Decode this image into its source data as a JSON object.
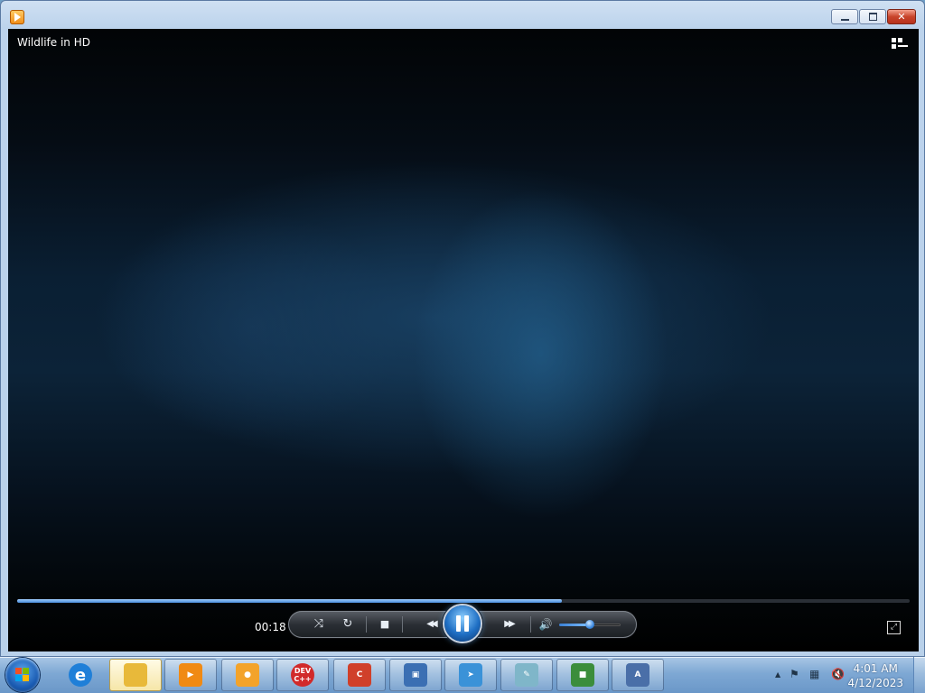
{
  "window": {
    "icons": {
      "app": "media-player-icon"
    }
  },
  "player": {
    "title": "Wildlife in HD",
    "elapsed": "00:18",
    "progress": 0.61,
    "volume": 0.5,
    "icons": {
      "switch_library": "switch-to-library-icon",
      "shuffle": "shuffle-icon",
      "repeat": "repeat-icon",
      "stop": "stop-icon",
      "previous": "previous-icon",
      "play_pause": "pause-icon",
      "next": "next-icon",
      "mute": "speaker-icon",
      "fullscreen": "fullscreen-icon"
    },
    "glyphs": {
      "shuffle": "⤨",
      "repeat": "↻",
      "stop": "■",
      "previous": "◀◀",
      "next": "▶▶",
      "mute": "🔊",
      "fullscreen": "⤢"
    }
  },
  "taskbar": {
    "pinned": [
      {
        "name": "internet-explorer",
        "label": "e",
        "color": "#1f7fd8"
      },
      {
        "name": "windows-explorer",
        "label": "",
        "color": "#e8b93a"
      },
      {
        "name": "windows-media-player",
        "label": "▶",
        "color": "#f08a14"
      },
      {
        "name": "avast-secureline",
        "label": "●",
        "color": "#f3a32a"
      },
      {
        "name": "dev-cpp",
        "label": "DEV C++",
        "color": "#d12a2a"
      },
      {
        "name": "ccleaner",
        "label": "C",
        "color": "#d0402a"
      },
      {
        "name": "remote-desktop",
        "label": "▣",
        "color": "#3b6fb3"
      },
      {
        "name": "telegram",
        "label": "➤",
        "color": "#3a92d8"
      },
      {
        "name": "notepad",
        "label": "✎",
        "color": "#7fb6c9"
      },
      {
        "name": "avg-antivirus",
        "label": "■",
        "color": "#3b8d3b"
      },
      {
        "name": "font-viewer",
        "label": "A",
        "color": "#4a6fa8"
      }
    ],
    "tray": {
      "icons": [
        "show-hidden-icons-icon",
        "action-center-flag-icon",
        "network-icon",
        "volume-muted-icon"
      ],
      "glyphs": [
        "▲",
        "⚑",
        "▦",
        "🔇"
      ]
    },
    "clock": {
      "time": "4:01 AM",
      "date": "4/12/2023"
    }
  }
}
